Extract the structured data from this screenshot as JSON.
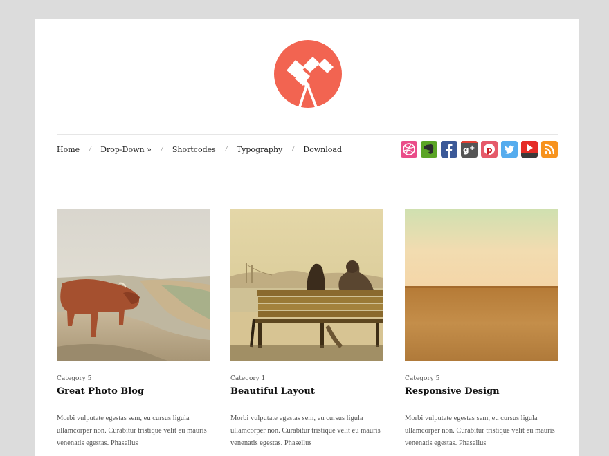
{
  "site": {
    "logo_icon": "telescope-icon",
    "accent_color": "#f26451"
  },
  "nav": {
    "items": [
      {
        "label": "Home"
      },
      {
        "label": "Drop-Down »"
      },
      {
        "label": "Shortcodes"
      },
      {
        "label": "Typography"
      },
      {
        "label": "Download"
      }
    ],
    "separator": "/"
  },
  "social": [
    {
      "name": "dribbble",
      "icon": "dribbble-icon",
      "color": "#ea4c89"
    },
    {
      "name": "evernote",
      "icon": "evernote-icon",
      "color": "#5ba525"
    },
    {
      "name": "facebook",
      "icon": "facebook-icon",
      "color": "#3b5998"
    },
    {
      "name": "google-plus",
      "icon": "google-plus-icon",
      "color": "#555555"
    },
    {
      "name": "pinterest",
      "icon": "pinterest-icon",
      "color": "#cb2027"
    },
    {
      "name": "twitter",
      "icon": "twitter-icon",
      "color": "#55acee"
    },
    {
      "name": "youtube",
      "icon": "youtube-icon",
      "color": "#e52d27"
    },
    {
      "name": "rss",
      "icon": "rss-icon",
      "color": "#f7931e"
    }
  ],
  "posts": [
    {
      "category": "Category 5",
      "title": "Great Photo Blog",
      "excerpt": "Morbi vulputate egestas sem, eu cursus ligula ullamcorper non. Curabitur tristique velit eu mauris venenatis egestas. Phasellus",
      "image": "highland-cow-on-cliff"
    },
    {
      "category": "Category 1",
      "title": "Beautiful Layout",
      "excerpt": "Morbi vulputate egestas sem, eu cursus ligula ullamcorper non. Curabitur tristique velit eu mauris venenatis egestas. Phasellus",
      "image": "couple-on-bench"
    },
    {
      "category": "Category 5",
      "title": "Responsive Design",
      "excerpt": "Morbi vulputate egestas sem, eu cursus ligula ullamcorper non. Curabitur tristique velit eu mauris venenatis egestas. Phasellus",
      "image": "desert-horizon"
    }
  ]
}
